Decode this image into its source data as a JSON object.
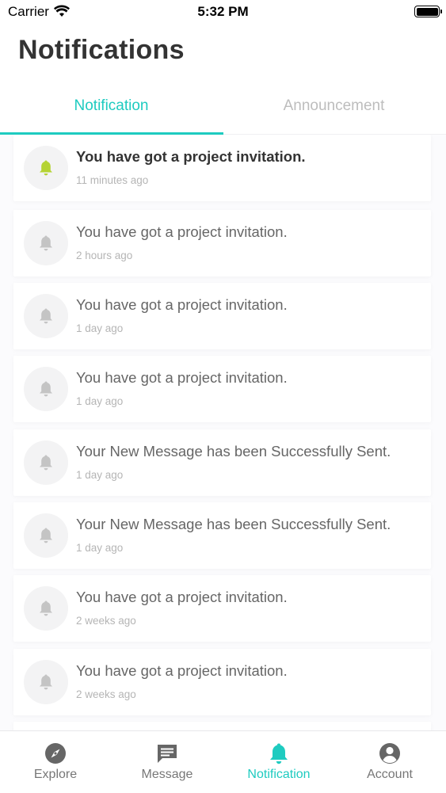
{
  "status_bar": {
    "carrier": "Carrier",
    "time": "5:32 PM"
  },
  "header": {
    "title": "Notifications"
  },
  "tabs": [
    {
      "label": "Notification",
      "active": true
    },
    {
      "label": "Announcement",
      "active": false
    }
  ],
  "notifications": [
    {
      "title": "You have got a project invitation.",
      "time": "11 minutes ago",
      "unread": true
    },
    {
      "title": "You have got a project invitation.",
      "time": "2 hours ago",
      "unread": false
    },
    {
      "title": "You have got a project invitation.",
      "time": "1 day ago",
      "unread": false
    },
    {
      "title": "You have got a project invitation.",
      "time": "1 day ago",
      "unread": false
    },
    {
      "title": "Your New Message has been Successfully Sent.",
      "time": "1 day ago",
      "unread": false
    },
    {
      "title": "Your New Message has been Successfully Sent.",
      "time": "1 day ago",
      "unread": false
    },
    {
      "title": "You have got a project invitation.",
      "time": "2 weeks ago",
      "unread": false
    },
    {
      "title": "You have got a project invitation.",
      "time": "2 weeks ago",
      "unread": false
    }
  ],
  "tabbar": [
    {
      "label": "Explore",
      "icon": "compass-icon",
      "active": false
    },
    {
      "label": "Message",
      "icon": "message-icon",
      "active": false
    },
    {
      "label": "Notification",
      "icon": "bell-icon",
      "active": true
    },
    {
      "label": "Account",
      "icon": "account-icon",
      "active": false
    }
  ],
  "colors": {
    "accent": "#1ecbc0",
    "unread_bell": "#b5d334",
    "read_bell": "#c4c4c4",
    "title": "#333333"
  }
}
